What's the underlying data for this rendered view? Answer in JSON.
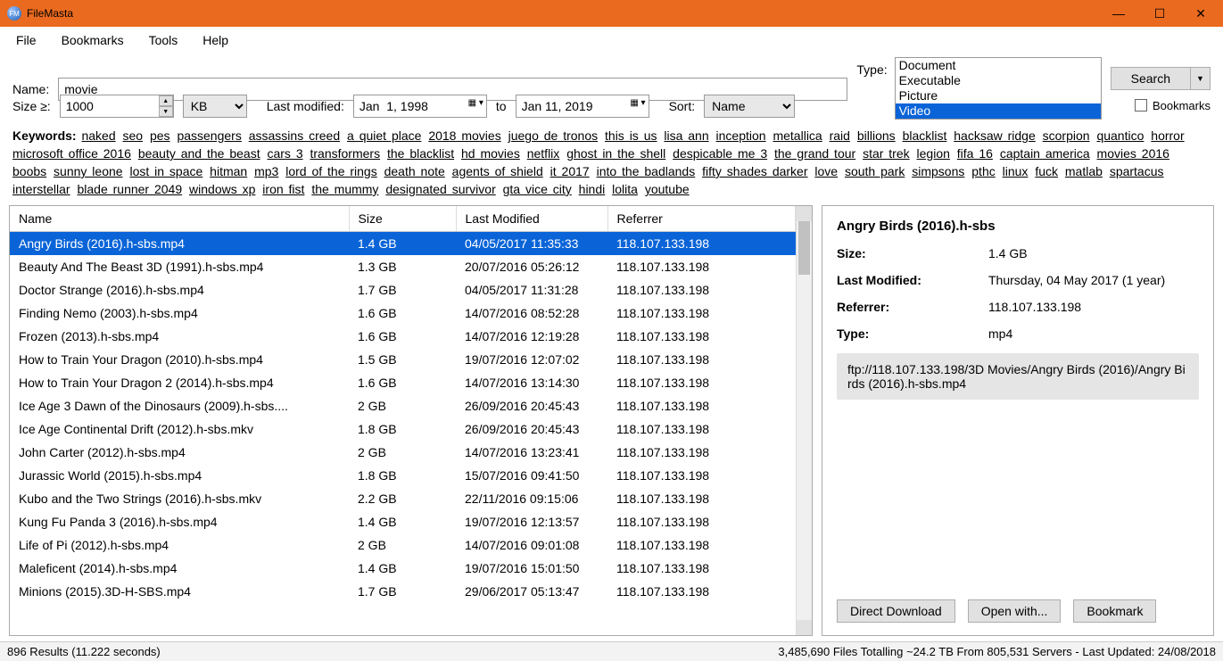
{
  "app": {
    "title": "FileMasta"
  },
  "menu": [
    "File",
    "Bookmarks",
    "Tools",
    "Help"
  ],
  "search": {
    "name_label": "Name:",
    "name_value": "movie",
    "type_label": "Type:",
    "type_options": [
      "Document",
      "Executable",
      "Picture",
      "Video"
    ],
    "type_selected": "Video",
    "search_btn": "Search",
    "size_label": "Size ≥:",
    "size_value": "1000",
    "size_unit": "KB",
    "lastmod_label": "Last modified:",
    "date_from": "Jan  1, 1998",
    "date_to_label": "to",
    "date_to": "Jan 11, 2019",
    "sort_label": "Sort:",
    "sort_value": "Name",
    "bookmarks_chk": "Bookmarks"
  },
  "keywords": {
    "label": "Keywords:",
    "list": [
      "naked",
      "seo",
      "pes",
      "passengers",
      "assassins creed",
      "a quiet place",
      "2018 movies",
      "juego de tronos",
      "this is us",
      "lisa ann",
      "inception",
      "metallica",
      "raid",
      "billions",
      "blacklist",
      "hacksaw ridge",
      "scorpion",
      "quantico",
      "horror",
      "microsoft office 2016",
      "beauty and the beast",
      "cars 3",
      "transformers",
      "the blacklist",
      "hd movies",
      "netflix",
      "ghost in the shell",
      "despicable me 3",
      "the grand tour",
      "star trek",
      "legion",
      "fifa 16",
      "captain america",
      "movies 2016",
      "boobs",
      "sunny leone",
      "lost in space",
      "hitman",
      "mp3",
      "lord of the rings",
      "death note",
      "agents of shield",
      "it 2017",
      "into the badlands",
      "fifty shades darker",
      "love",
      "south park",
      "simpsons",
      "pthc",
      "linux",
      "fuck",
      "matlab",
      "spartacus",
      "interstellar",
      "blade runner 2049",
      "windows xp",
      "iron fist",
      "the mummy",
      "designated survivor",
      "gta vice city",
      "hindi",
      "lolita",
      "youtube"
    ]
  },
  "table": {
    "headers": [
      "Name",
      "Size",
      "Last Modified",
      "Referrer"
    ],
    "rows": [
      {
        "name": "Angry Birds (2016).h-sbs.mp4",
        "size": "1.4 GB",
        "mod": "04/05/2017 11:35:33",
        "ref": "118.107.133.198",
        "sel": true
      },
      {
        "name": "Beauty And The Beast 3D (1991).h-sbs.mp4",
        "size": "1.3 GB",
        "mod": "20/07/2016 05:26:12",
        "ref": "118.107.133.198"
      },
      {
        "name": "Doctor Strange (2016).h-sbs.mp4",
        "size": "1.7 GB",
        "mod": "04/05/2017 11:31:28",
        "ref": "118.107.133.198"
      },
      {
        "name": "Finding Nemo (2003).h-sbs.mp4",
        "size": "1.6 GB",
        "mod": "14/07/2016 08:52:28",
        "ref": "118.107.133.198"
      },
      {
        "name": "Frozen (2013).h-sbs.mp4",
        "size": "1.6 GB",
        "mod": "14/07/2016 12:19:28",
        "ref": "118.107.133.198"
      },
      {
        "name": "How to Train Your Dragon (2010).h-sbs.mp4",
        "size": "1.5 GB",
        "mod": "19/07/2016 12:07:02",
        "ref": "118.107.133.198"
      },
      {
        "name": "How to Train Your Dragon 2 (2014).h-sbs.mp4",
        "size": "1.6 GB",
        "mod": "14/07/2016 13:14:30",
        "ref": "118.107.133.198"
      },
      {
        "name": "Ice Age 3 Dawn of the Dinosaurs (2009).h-sbs....",
        "size": "2 GB",
        "mod": "26/09/2016 20:45:43",
        "ref": "118.107.133.198"
      },
      {
        "name": "Ice Age Continental Drift (2012).h-sbs.mkv",
        "size": "1.8 GB",
        "mod": "26/09/2016 20:45:43",
        "ref": "118.107.133.198"
      },
      {
        "name": "John Carter (2012).h-sbs.mp4",
        "size": "2 GB",
        "mod": "14/07/2016 13:23:41",
        "ref": "118.107.133.198"
      },
      {
        "name": "Jurassic World (2015).h-sbs.mp4",
        "size": "1.8 GB",
        "mod": "15/07/2016 09:41:50",
        "ref": "118.107.133.198"
      },
      {
        "name": "Kubo and the Two Strings (2016).h-sbs.mkv",
        "size": "2.2 GB",
        "mod": "22/11/2016 09:15:06",
        "ref": "118.107.133.198"
      },
      {
        "name": "Kung Fu Panda 3 (2016).h-sbs.mp4",
        "size": "1.4 GB",
        "mod": "19/07/2016 12:13:57",
        "ref": "118.107.133.198"
      },
      {
        "name": "Life of Pi (2012).h-sbs.mp4",
        "size": "2 GB",
        "mod": "14/07/2016 09:01:08",
        "ref": "118.107.133.198"
      },
      {
        "name": "Maleficent (2014).h-sbs.mp4",
        "size": "1.4 GB",
        "mod": "19/07/2016 15:01:50",
        "ref": "118.107.133.198"
      },
      {
        "name": "Minions (2015).3D-H-SBS.mp4",
        "size": "1.7 GB",
        "mod": "29/06/2017 05:13:47",
        "ref": "118.107.133.198"
      }
    ]
  },
  "details": {
    "title": "Angry Birds (2016).h-sbs",
    "size_k": "Size:",
    "size_v": "1.4 GB",
    "mod_k": "Last Modified:",
    "mod_v": "Thursday, 04 May 2017 (1 year)",
    "ref_k": "Referrer:",
    "ref_v": "118.107.133.198",
    "type_k": "Type:",
    "type_v": "mp4",
    "url": "ftp://118.107.133.198/3D Movies/Angry Birds (2016)/Angry Birds (2016).h-sbs.mp4",
    "btn_download": "Direct Download",
    "btn_open": "Open with...",
    "btn_bookmark": "Bookmark"
  },
  "status": {
    "left": "896 Results (11.222 seconds)",
    "right": "3,485,690 Files Totalling ~24.2 TB From 805,531 Servers - Last Updated: 24/08/2018"
  }
}
